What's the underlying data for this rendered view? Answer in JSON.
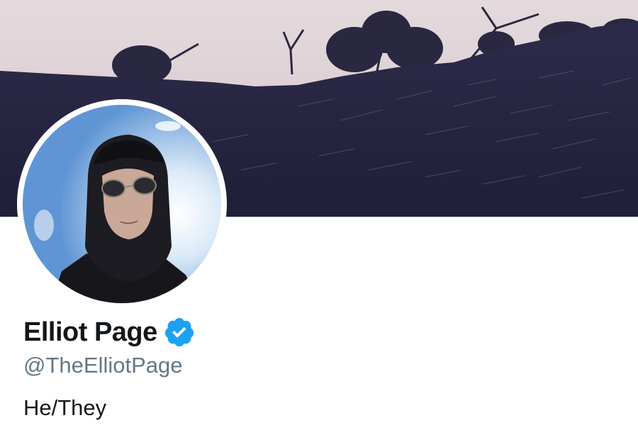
{
  "profile": {
    "display_name": "Elliot Page",
    "handle": "@TheElliotPage",
    "bio": "He/They",
    "verified": true
  },
  "icons": {
    "verified": "verified-badge-icon",
    "avatar": "profile-photo",
    "banner": "header-photo"
  },
  "colors": {
    "name": "#14171a",
    "handle": "#657786",
    "verified": "#1da1f2",
    "banner_sky": "#e2d7da",
    "banner_hill": "#262641"
  }
}
